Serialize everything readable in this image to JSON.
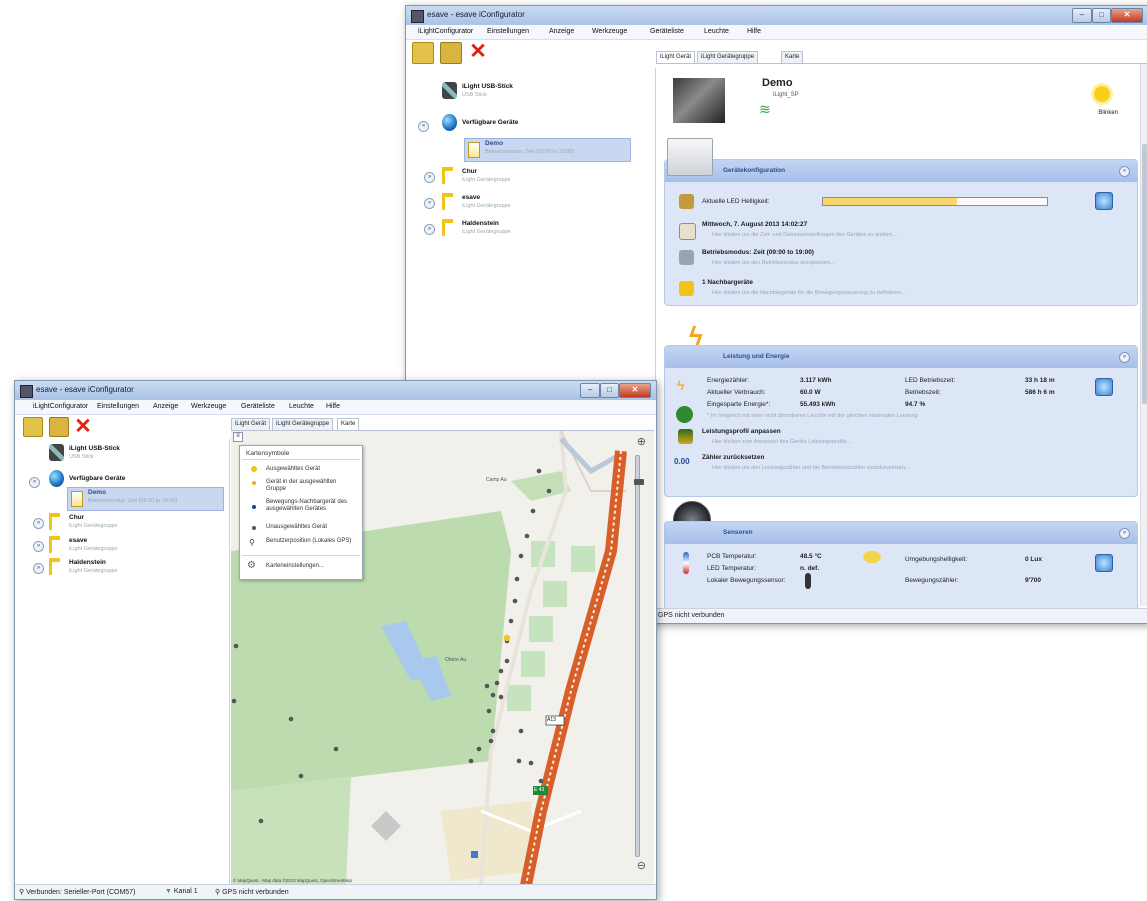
{
  "app": {
    "window_title": "esave - esave iConfigurator"
  },
  "menu": [
    "iLightConfigurator",
    "Einstellungen",
    "Anzeige",
    "Werkzeuge",
    "Geräteliste",
    "Leuchte",
    "Hilfe"
  ],
  "tree": {
    "usb": {
      "label": "iLight USB-Stick",
      "sub": "USB Stick"
    },
    "available": {
      "label": "Verfügbare Geräte"
    },
    "demo": {
      "label": "Demo",
      "sub": "Betriebsmodus: Zeit (09:00 to 19:00)"
    },
    "groups": [
      {
        "label": "Chur",
        "sub": "iLight Gerätegruppe"
      },
      {
        "label": "esave",
        "sub": "iLight Gerätegruppe"
      },
      {
        "label": "Haldenstein",
        "sub": "iLight Gerätegruppe"
      }
    ]
  },
  "tabs": [
    "iLight Gerät",
    "iLight Gerätegruppe",
    "Karte"
  ],
  "device": {
    "name": "Demo",
    "type": "iLight_SP",
    "blink_label": "Blinken"
  },
  "sections": {
    "config": {
      "title": "Gerätekonfiguration",
      "led_label": "Aktuelle LED Helligkeit:",
      "led_level": 0.6,
      "date_title": "Mittwoch, 7. August 2013 14:02:27",
      "date_sub": "Hier klicken um die Zeit- und Datumseinstellungen des Gerätes zu ändern...",
      "mode_title": "Betriebsmodus: Zeit (09:00 to 19:00)",
      "mode_sub": "Hier klicken um den Betriebsmodus anzupassen...",
      "neighbors_title": "1 Nachbargeräte",
      "neighbors_sub": "Hier klicken um die Nachbargeräte für die Bewegungssteuerung zu definieren..."
    },
    "energy": {
      "title": "Leistung und Energie",
      "rows": [
        {
          "label": "Energiezähler:",
          "value": "3.117 kWh",
          "label2": "LED Betriebszeit:",
          "value2": "33 h 18 m"
        },
        {
          "label": "Aktueller Verbrauch:",
          "value": "60.0 W",
          "label2": "Betriebszeit:",
          "value2": "586 h 6 m"
        },
        {
          "label": "Eingesparte Energie*:",
          "value": "55.493 kWh",
          "label2": "",
          "value2": "94.7 %"
        }
      ],
      "footnote": "* Im Vergleich mit einer nicht dimmbaren Leuchte mit der gleichen maximalen Leistung",
      "profile_title": "Leistungsprofil anpassen",
      "profile_sub": "Hier klicken zum Anpassen des Geräte Leistungsprofils...",
      "reset_title": "Zähler zurücksetzen",
      "reset_sub": "Hier klicken um den Leistungszähler und die Betriebszeitzähler zurückzusetzen...",
      "reset_icon_text": "0.00"
    },
    "sensors": {
      "title": "Sensoren",
      "rows": [
        {
          "label": "PCB Temperatur:",
          "value": "48.5 °C",
          "label2": "Umgebungshelligkeit:",
          "value2": "0 Lux"
        },
        {
          "label": "LED Temperatur:",
          "value": "n. def.",
          "label2": "Bewegungszähler:",
          "value2": "9'700"
        },
        {
          "label": "Lokaler Bewegungssensor:",
          "value": "",
          "label2": "",
          "value2": ""
        }
      ]
    }
  },
  "status_right": "GPS nicht verbunden",
  "legend": {
    "title": "Kartensymbole",
    "items": [
      "Ausgewähltes Gerät",
      "Gerät in der ausgewählten Gruppe",
      "Bewegungs-Nachbargerät des ausgewählten Gerätes",
      "Unausgewähltes Gerät",
      "Benutzerposition (Lokales GPS)"
    ],
    "settings": "Karteneinstellungen..."
  },
  "map": {
    "labels": {
      "camp": "Camp Au",
      "obere": "Obere Au",
      "a13": "A13",
      "e43": "E 43"
    },
    "attribution": "© MapQuest - Map data ©2013 MapQuest, OpenStreetMap"
  },
  "status_left": {
    "connected": "Verbunden: Serieller-Port (COM57)",
    "channel": "Kanal 1",
    "gps": "GPS nicht verbunden"
  },
  "colors": {
    "selected_dot": "#f0c418",
    "group_dot": "#e2b714",
    "neighbor_dot": "#1b3fa0",
    "unselected_dot": "#555555",
    "road": "#d95f2a",
    "park": "#bcdcb0",
    "water": "#a8c8ee"
  }
}
